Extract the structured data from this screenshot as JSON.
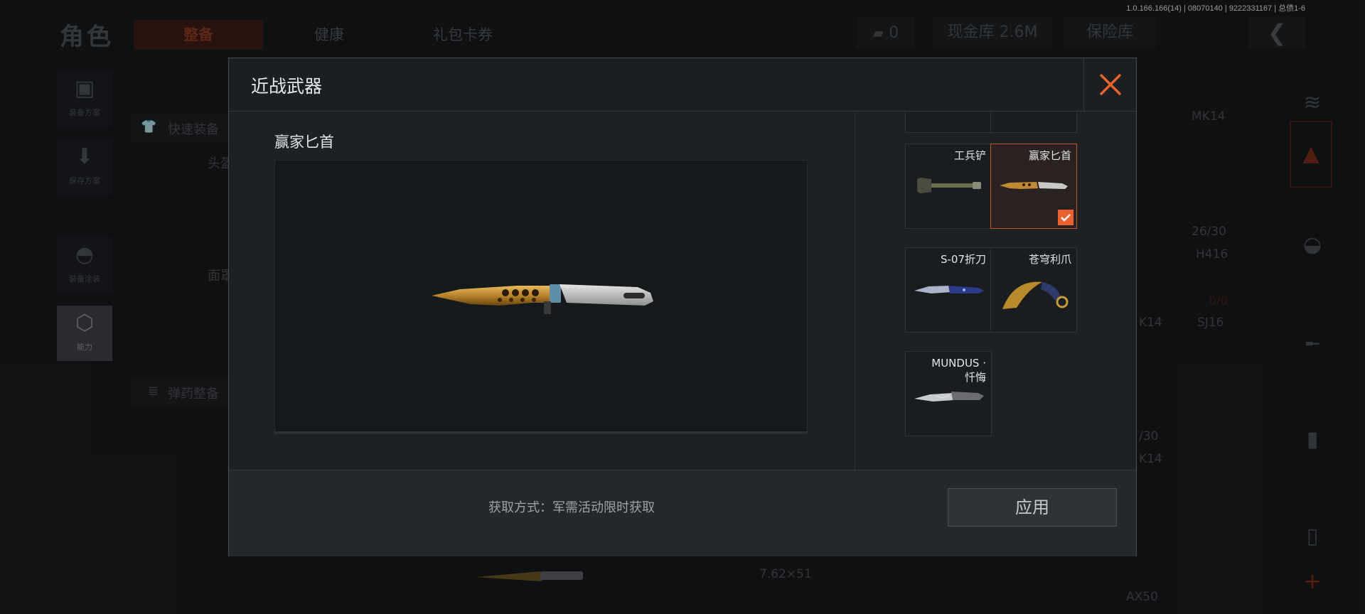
{
  "version_info": "1.0.166.166(14) | 08070140 | 9222331167 | 总债1-6",
  "background": {
    "title": "角色",
    "tabs": [
      "整备",
      "健康",
      "礼包卡券"
    ],
    "currency_count": "0",
    "cash_vault": "现金库 2.6M",
    "safe_box": "保险库",
    "left_rail": [
      "装备方案",
      "保存方案",
      "装备涂装",
      "能力"
    ],
    "quick_equip": "快速装备",
    "ammo_prep": "弹药整备",
    "side_labels": [
      "头盔",
      "面罩"
    ],
    "weapons": [
      "MK14",
      "26/30",
      "H416",
      "0/0",
      "SJ16",
      "K14",
      "/30",
      "K14",
      "7.62×51",
      "AX50"
    ]
  },
  "modal": {
    "title": "近战武器",
    "selected_name": "赢家匕首",
    "acquire_method": "获取方式：军需活动限时获取",
    "apply_label": "应用",
    "items": [
      {
        "label": "工兵铲",
        "icon": "shovel-icon",
        "selected": false
      },
      {
        "label": "赢家匕首",
        "icon": "gold-knife-icon",
        "selected": true
      },
      {
        "label": "S-07折刀",
        "icon": "folding-knife-icon",
        "selected": false
      },
      {
        "label": "苍穹利爪",
        "icon": "karambit-icon",
        "selected": false
      },
      {
        "label": "MUNDUS · 忏悔",
        "icon": "mundus-knife-icon",
        "selected": false
      }
    ]
  },
  "colors": {
    "accent": "#e8612e",
    "selected_border": "#c0552a"
  }
}
